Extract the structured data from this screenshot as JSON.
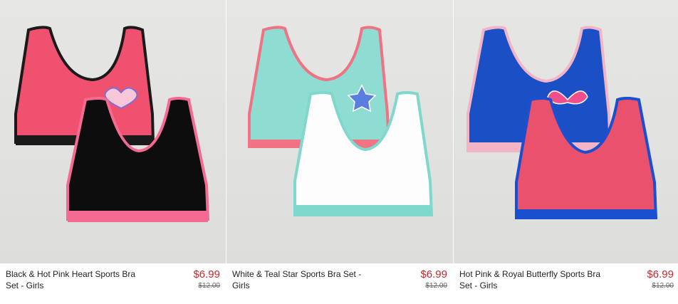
{
  "products": [
    {
      "title": "Black & Hot Pink Heart Sports Bra Set - Girls",
      "price": "$6.99",
      "original_price": "$12.00",
      "colors": {
        "back_body": "#f0516f",
        "back_trim": "#1a1a1a",
        "front_body": "#0d0d0d",
        "front_trim": "#f56a92"
      }
    },
    {
      "title": "White & Teal Star Sports Bra Set - Girls",
      "price": "$6.99",
      "original_price": "$12.00",
      "colors": {
        "back_body": "#8fdcd3",
        "back_trim": "#f07283",
        "front_body": "#fdfdfd",
        "front_trim": "#7fd8cc"
      }
    },
    {
      "title": "Hot Pink & Royal Butterfly Sports Bra Set - Girls",
      "price": "$6.99",
      "original_price": "$12.00",
      "colors": {
        "back_body": "#1b4fc6",
        "back_trim": "#f3b4c6",
        "front_body": "#e9516d",
        "front_trim": "#1a4fd0"
      }
    }
  ]
}
